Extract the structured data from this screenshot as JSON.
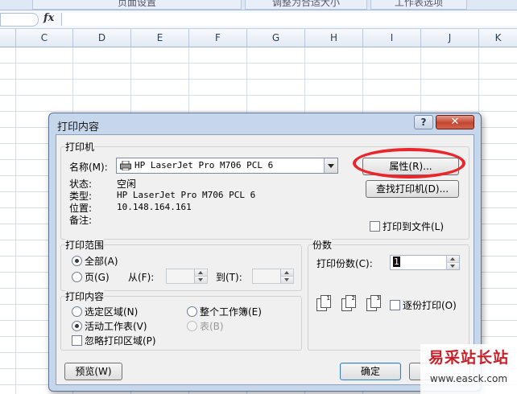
{
  "ribbon": {
    "items": [
      "页面设置",
      "调整为合适大小",
      "工作表选项"
    ]
  },
  "formula_bar": {
    "fx_label": "fx"
  },
  "sheet": {
    "columns": [
      "C",
      "D",
      "E",
      "F",
      "G",
      "H",
      "I",
      "J",
      "K"
    ]
  },
  "dialog": {
    "title": "打印内容",
    "help_label": "?",
    "close_label": "✕",
    "printer": {
      "group_label": "打印机",
      "name_label": "名称(M):",
      "name_value": "HP LaserJet Pro M706 PCL 6",
      "properties_button": "属性(R)...",
      "find_printer_button": "查找打印机(D)...",
      "status_label": "状态:",
      "status_value": "空闲",
      "type_label": "类型:",
      "type_value": "HP LaserJet Pro M706 PCL 6",
      "location_label": "位置:",
      "location_value": "10.148.164.161",
      "comment_label": "备注:",
      "print_to_file_label": "打印到文件(L)"
    },
    "print_range": {
      "group_label": "打印范围",
      "all_label": "全部(A)",
      "pages_label": "页(G)",
      "from_label": "从(F):",
      "to_label": "到(T):"
    },
    "copies": {
      "group_label": "份数",
      "count_label": "打印份数(C):",
      "count_value": "1",
      "collate_label": "逐份打印(O)"
    },
    "print_what": {
      "group_label": "打印内容",
      "selection_label": "选定区域(N)",
      "active_sheets_label": "活动工作表(V)",
      "entire_workbook_label": "整个工作簿(E)",
      "table_label": "表(B)",
      "ignore_area_label": "忽略打印区域(P)"
    },
    "preview_button": "预览(W)",
    "ok_button": "确定"
  },
  "watermark": {
    "brand": "易采站长站",
    "url": "www.easck.com"
  },
  "colors": {
    "accent_ring": "#e8262c",
    "dialog_frame": "#c6d7ec"
  }
}
